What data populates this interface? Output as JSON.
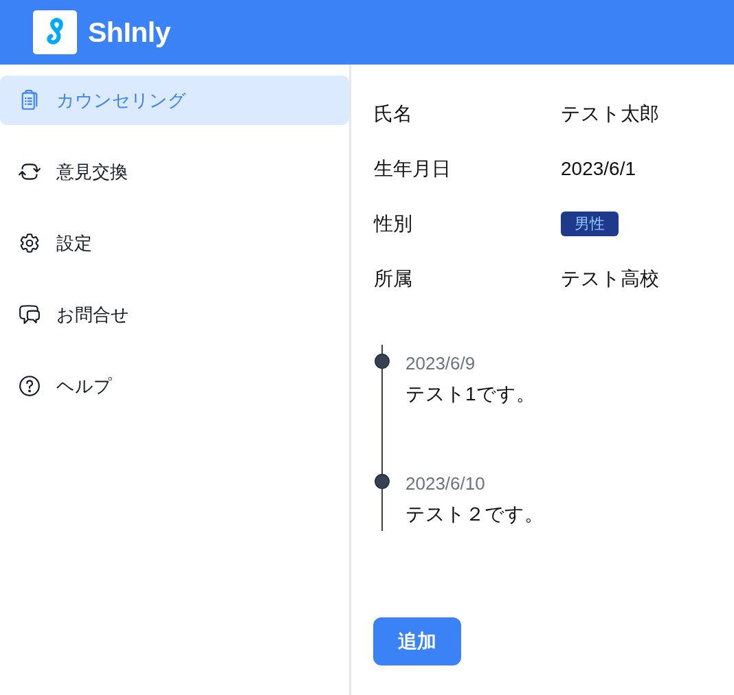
{
  "header": {
    "brand": "ShInly"
  },
  "sidebar": {
    "items": [
      {
        "label": "カウンセリング",
        "selected": true
      },
      {
        "label": "意見交換",
        "selected": false
      },
      {
        "label": "設定",
        "selected": false
      },
      {
        "label": "お問合せ",
        "selected": false
      },
      {
        "label": "ヘルプ",
        "selected": false
      }
    ]
  },
  "profile": {
    "fields": [
      {
        "label": "氏名",
        "value": "テスト太郎",
        "kind": "text"
      },
      {
        "label": "生年月日",
        "value": "2023/6/1",
        "kind": "text"
      },
      {
        "label": "性別",
        "value": "男性",
        "kind": "badge"
      },
      {
        "label": "所属",
        "value": "テスト高校",
        "kind": "text"
      }
    ]
  },
  "timeline": {
    "entries": [
      {
        "date": "2023/6/9",
        "text": "テスト1です。"
      },
      {
        "date": "2023/6/10",
        "text": "テスト２です。"
      }
    ]
  },
  "add_button": {
    "label": "追加"
  }
}
